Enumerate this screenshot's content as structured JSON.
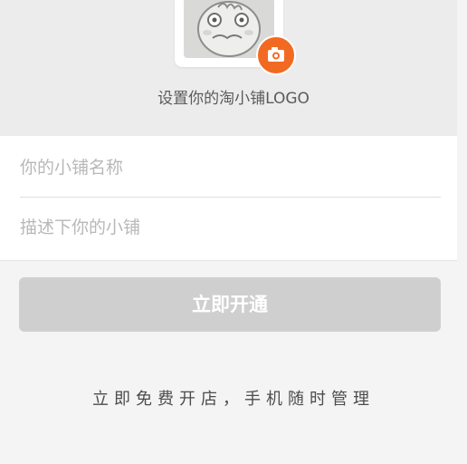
{
  "logo": {
    "caption": "设置你的淘小铺LOGO",
    "accent_color": "#f26a21",
    "avatar_icon": "cartoon-face",
    "camera_icon": "camera-icon"
  },
  "form": {
    "shop_name_placeholder": "你的小铺名称",
    "shop_desc_placeholder": "描述下你的小铺"
  },
  "actions": {
    "open_label": "立即开通"
  },
  "footer": {
    "slogan": "立即免费开店，手机随时管理"
  }
}
